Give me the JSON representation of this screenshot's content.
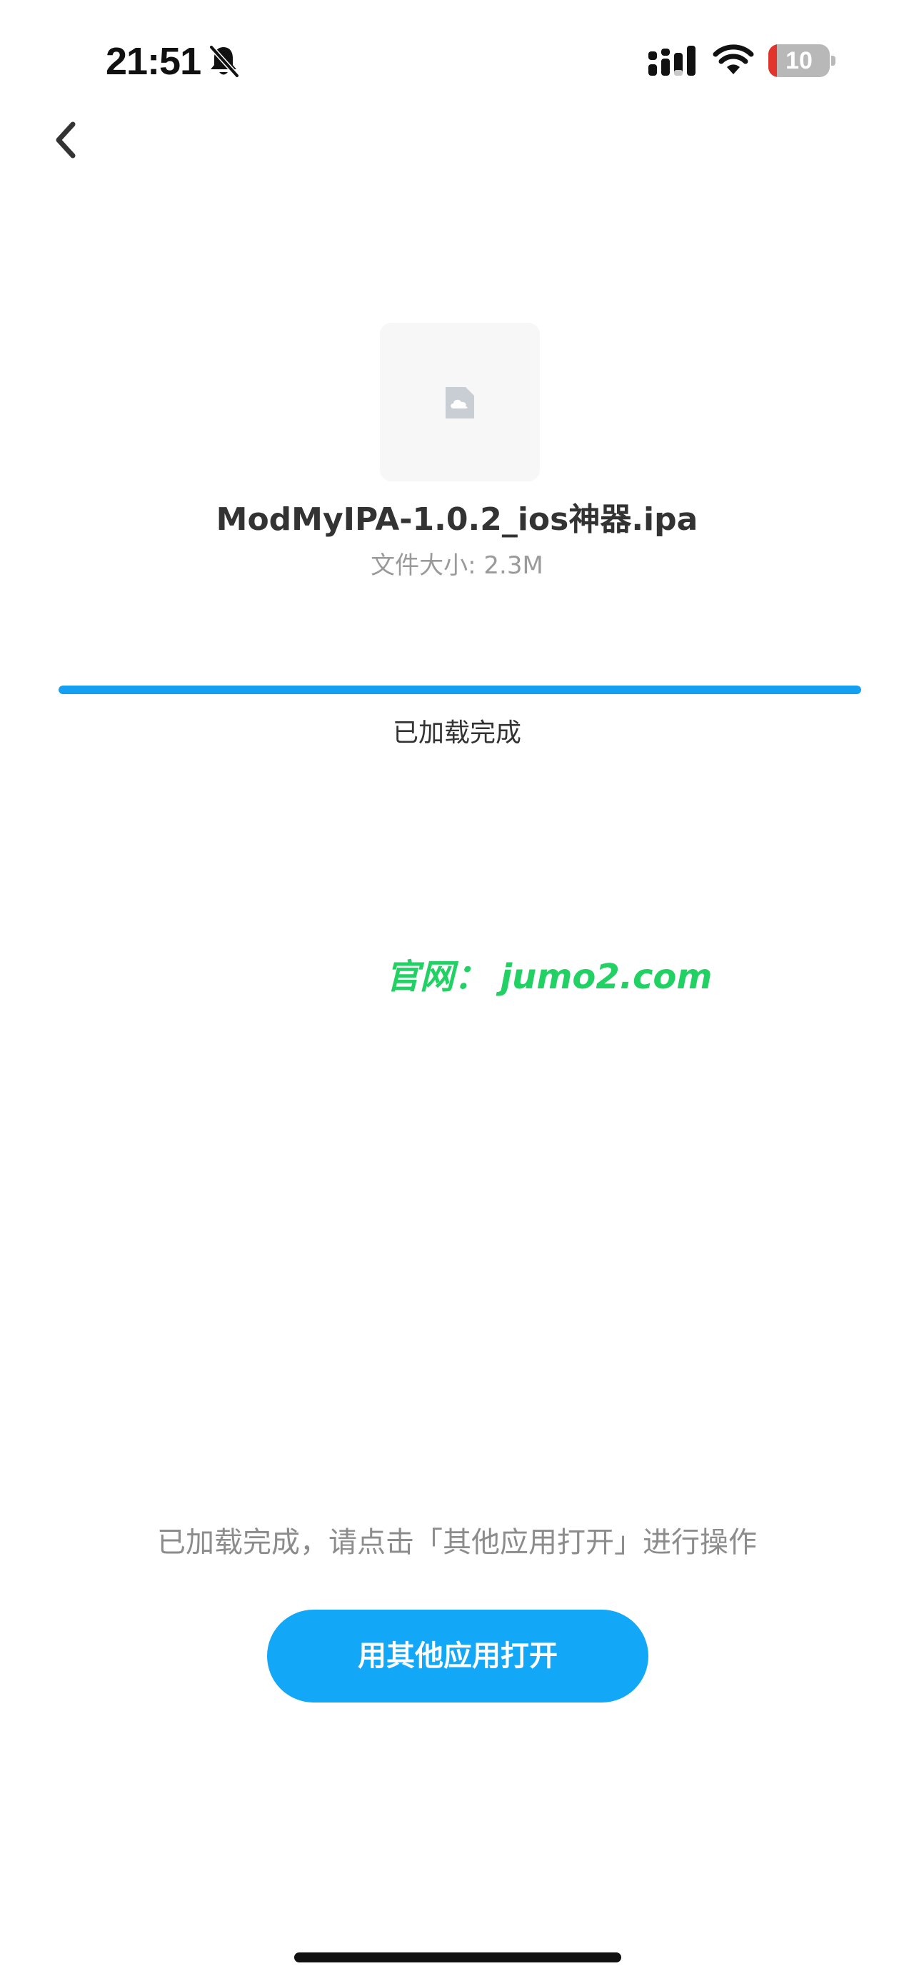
{
  "status_bar": {
    "time": "21:51",
    "battery_level": "10",
    "icons": [
      "bell-slash-icon",
      "cellular-signal-icon",
      "wifi-icon",
      "battery-icon"
    ]
  },
  "nav": {
    "back_icon": "chevron-left-icon"
  },
  "file": {
    "icon": "cloud-file-icon",
    "name": "ModMyIPA-1.0.2_ios神器.ipa",
    "size_text": "文件大小: 2.3M"
  },
  "progress": {
    "percent": 100,
    "status_text": "已加载完成"
  },
  "watermark": {
    "text": "官网： jumo2.com"
  },
  "actions": {
    "hint_text": "已加载完成，请点击「其他应用打开」进行操作",
    "open_button_label": "用其他应用打开"
  },
  "colors": {
    "accent": "#12a8f7",
    "progress": "#159ff0",
    "watermark": "#22d163"
  }
}
